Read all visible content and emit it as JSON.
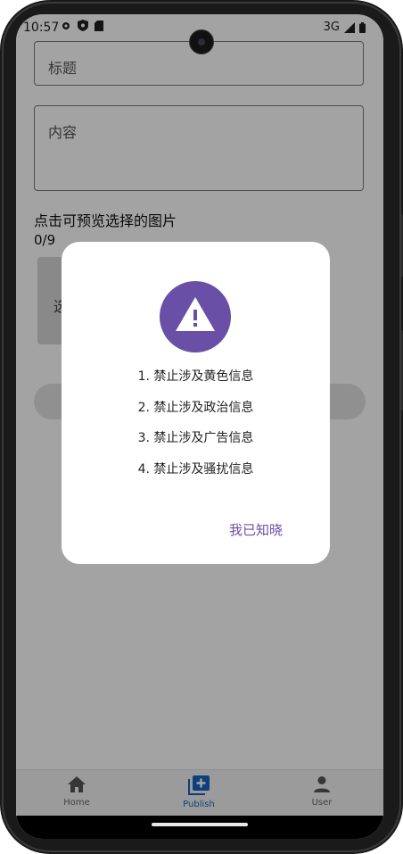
{
  "status_bar": {
    "time": "10:57",
    "network": "3G",
    "icons": [
      "gear-icon",
      "shield-icon",
      "sim-card-icon",
      "signal-icon",
      "battery-icon"
    ]
  },
  "form": {
    "title_placeholder": "标题",
    "content_placeholder": "内容",
    "preview_label": "点击可预览选择的图片",
    "image_count": "0/9",
    "image_slot_label": "选"
  },
  "dialog": {
    "icon": "warning-icon",
    "accent_color": "#6a4fa6",
    "rules": [
      "1. 禁止涉及黄色信息",
      "2. 禁止涉及政治信息",
      "3. 禁止涉及广告信息",
      "4. 禁止涉及骚扰信息"
    ],
    "ack_label": "我已知晓"
  },
  "bottom_nav": {
    "items": [
      {
        "label": "Home",
        "icon": "home-icon",
        "active": false
      },
      {
        "label": "Publish",
        "icon": "add-photo-icon",
        "active": true
      },
      {
        "label": "User",
        "icon": "user-icon",
        "active": false
      }
    ],
    "active_color": "#1565c0"
  }
}
